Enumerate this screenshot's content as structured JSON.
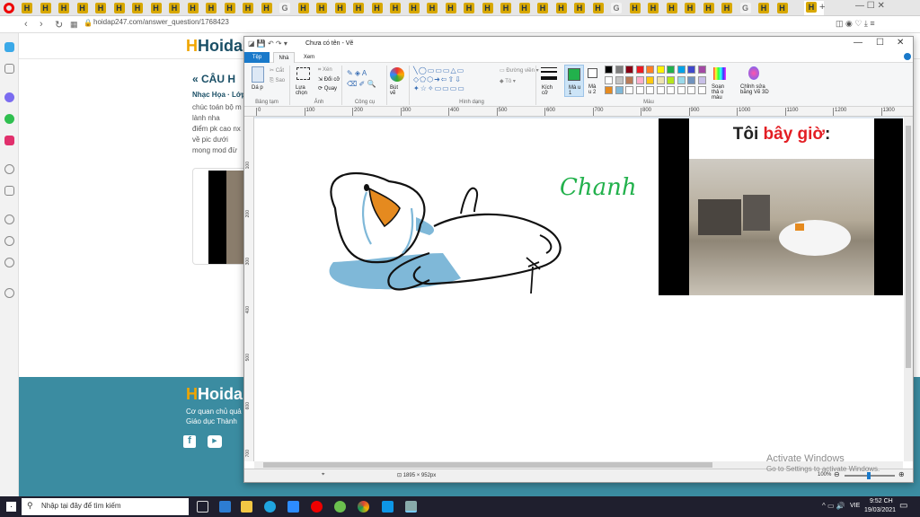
{
  "browser": {
    "url": "hoidap247.com/answer_question/1768423",
    "tabs": [
      "H",
      "H",
      "H",
      "H",
      "H",
      "H",
      "H",
      "H",
      "H",
      "H",
      "H",
      "H",
      "H",
      "H",
      "G",
      "H",
      "H",
      "H",
      "H",
      "H",
      "H",
      "H",
      "H",
      "H",
      "H",
      "H",
      "H",
      "H",
      "H",
      "H",
      "H",
      "H",
      "G",
      "H",
      "H",
      "H",
      "H",
      "H",
      "H",
      "G",
      "H",
      "H"
    ],
    "active_tab_label": "H",
    "new_tab_label": "+"
  },
  "site": {
    "logo": "Hoidap",
    "question_heading": "« CÂU H",
    "author_line": "Nhạc Họa · Lớp",
    "question_lines": [
      "chúc toán bộ m",
      "lành nha",
      "điểm pk cao nx",
      "về pic dưới",
      "mong mod đừ"
    ],
    "footer_logo": "Hoidap",
    "footer_line1": "Cơ quan chủ quả",
    "footer_line2": "Giáo dục Thành"
  },
  "paint": {
    "title": "Chưa có tên - Vẽ",
    "ribbon_tabs": [
      "Tệp",
      "Nhà",
      "Xem"
    ],
    "ribbon": {
      "paste": "Dá p",
      "cut": "Cắt",
      "copy": "Sao",
      "select": "Lựa chọn",
      "crop": "Xén",
      "resize": "Đổi cỡ",
      "rotate": "Quay",
      "brush": "Bút vẽ",
      "outline": "Đường viền",
      "fill": "Tô",
      "size": "Kích cỡ",
      "color1": "Mà u 1",
      "color2": "Mà u 2",
      "edit_colors": "Soạn thả o màu",
      "paint3d": "Chỉnh sửa bằng Vẽ 3D"
    },
    "groups": [
      "Bảng tạm",
      "Ảnh",
      "Công cụ",
      "Hình dạng",
      "Màu"
    ],
    "ruler_ticks": [
      "0",
      "100",
      "200",
      "300",
      "400",
      "500",
      "600",
      "700",
      "800",
      "900",
      "1000",
      "1100",
      "1200",
      "1300"
    ],
    "vruler_ticks": [
      "100",
      "200",
      "300",
      "400",
      "500",
      "600",
      "700"
    ],
    "handwriting": "Chanh",
    "meme_caption": {
      "part1": "Tôi ",
      "part2": "bây giờ",
      "part3": ":"
    },
    "status": {
      "size": "1895 × 952px",
      "zoom": "100%"
    },
    "palette": [
      "#000000",
      "#7f7f7f",
      "#880015",
      "#ed1c24",
      "#ff7f27",
      "#fff200",
      "#22b14c",
      "#00a2e8",
      "#3f48cc",
      "#a349a4",
      "#ffffff",
      "#c3c3c3",
      "#b97a57",
      "#ffaec9",
      "#ffc90e",
      "#efe4b0",
      "#b5e61d",
      "#99d9ea",
      "#7092be",
      "#c8bfe7",
      "#e58a1f",
      "#7fb8d8",
      "#ffffff",
      "#ffffff",
      "#ffffff",
      "#ffffff",
      "#ffffff",
      "#ffffff",
      "#ffffff",
      "#ffffff"
    ]
  },
  "watermark": {
    "line1": "Activate Windows",
    "line2": "Go to Settings to activate Windows."
  },
  "taskbar": {
    "search_placeholder": "Nhập tại đây để tìm kiếm",
    "time": "9:52 CH",
    "date": "19/03/2021",
    "lang": "VIE"
  }
}
